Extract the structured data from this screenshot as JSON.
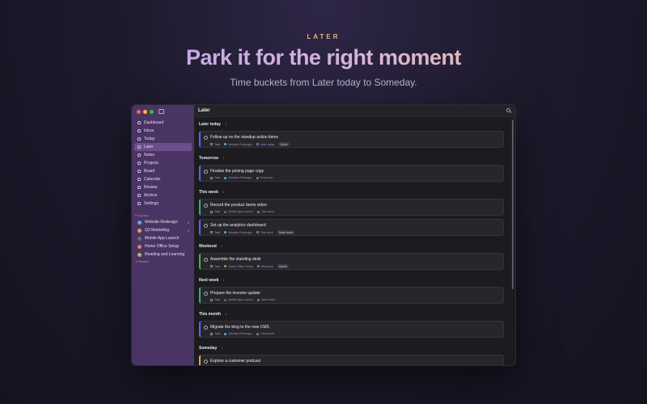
{
  "hero": {
    "eyebrow": "LATER",
    "title": "Park it for the right moment",
    "subtitle": "Time buckets from Later today to Someday."
  },
  "window": {
    "title": "Later"
  },
  "sidebar": {
    "nav": [
      {
        "label": "Dashboard"
      },
      {
        "label": "Inbox"
      },
      {
        "label": "Today"
      },
      {
        "label": "Later",
        "active": true
      },
      {
        "label": "Notes"
      },
      {
        "label": "Projects"
      },
      {
        "label": "Board"
      },
      {
        "label": "Calendar"
      },
      {
        "label": "Review"
      },
      {
        "label": "Archive"
      },
      {
        "label": "Settings"
      }
    ],
    "projects_label": "Projects",
    "projects": [
      {
        "label": "Website Redesign",
        "count": "4",
        "color": "#5aa8e6"
      },
      {
        "label": "Q3 Marketing",
        "count": "4",
        "color": "#e8a24a"
      },
      {
        "label": "Mobile App Launch",
        "count": "",
        "color": "#6a6a78"
      },
      {
        "label": "Home Office Setup",
        "count": "",
        "color": "#d2884a"
      },
      {
        "label": "Reading and Learning",
        "count": "",
        "color": "#c9a76a"
      }
    ],
    "paused_label": "1 Paused"
  },
  "buckets": [
    {
      "name": "Later today",
      "count": "1",
      "tasks": [
        {
          "title": "Follow up on the standup action items",
          "type": "Task",
          "project": "Website Redesign",
          "when": "Later today",
          "tag": "Quick",
          "accent": "#5865f2",
          "project_color": "#5aa8e6"
        }
      ]
    },
    {
      "name": "Tomorrow",
      "count": "1",
      "tasks": [
        {
          "title": "Finalise the pricing page copy",
          "type": "Task",
          "project": "Website Redesign",
          "when": "Tomorrow",
          "tag": "",
          "accent": "#5865f2",
          "project_color": "#5aa8e6"
        }
      ]
    },
    {
      "name": "This week",
      "count": "2",
      "tasks": [
        {
          "title": "Record the product demo video",
          "type": "Task",
          "project": "Mobile App Launch",
          "when": "This week",
          "tag": "",
          "accent": "#3fa58f",
          "project_color": "#6a6a78"
        },
        {
          "title": "Set up the analytics dashboard",
          "type": "Task",
          "project": "Website Redesign",
          "when": "This week",
          "tag": "Deep work",
          "accent": "#5865f2",
          "project_color": "#5aa8e6"
        }
      ]
    },
    {
      "name": "Weekend",
      "count": "1",
      "tasks": [
        {
          "title": "Assemble the standing desk",
          "type": "Task",
          "project": "Home Office Setup",
          "when": "Weekend",
          "tag": "Admin",
          "accent": "#4caf50",
          "project_color": "#d2884a"
        }
      ]
    },
    {
      "name": "Next week",
      "count": "1",
      "tasks": [
        {
          "title": "Prepare the investor update",
          "type": "Task",
          "project": "Mobile App Launch",
          "when": "Next week",
          "tag": "",
          "accent": "#3fa58f",
          "project_color": "#6a6a78"
        }
      ]
    },
    {
      "name": "This month",
      "count": "1",
      "tasks": [
        {
          "title": "Migrate the blog to the new CMS",
          "type": "Task",
          "project": "Website Redesign",
          "when": "This month",
          "tag": "",
          "accent": "#5865f2",
          "project_color": "#5aa8e6"
        }
      ]
    },
    {
      "name": "Someday",
      "count": "1",
      "tasks": [
        {
          "title": "Explore a customer podcast",
          "type": "",
          "project": "",
          "when": "",
          "tag": "",
          "accent": "#e8a24a",
          "project_color": "#6a6a78"
        }
      ]
    }
  ]
}
